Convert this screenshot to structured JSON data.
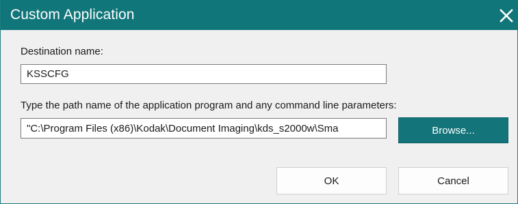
{
  "window": {
    "title": "Custom Application",
    "close_icon": "close-icon",
    "titlebar_color": "#11767a"
  },
  "destination": {
    "label": "Destination name:",
    "value": "KSSCFG"
  },
  "path": {
    "label": "Type the path name of the application program and any command line parameters:",
    "value": "\"C:\\Program Files (x86)\\Kodak\\Document Imaging\\kds_s2000w\\Sma"
  },
  "buttons": {
    "browse_label": "Browse...",
    "ok_label": "OK",
    "cancel_label": "Cancel",
    "accent_color": "#137479"
  }
}
